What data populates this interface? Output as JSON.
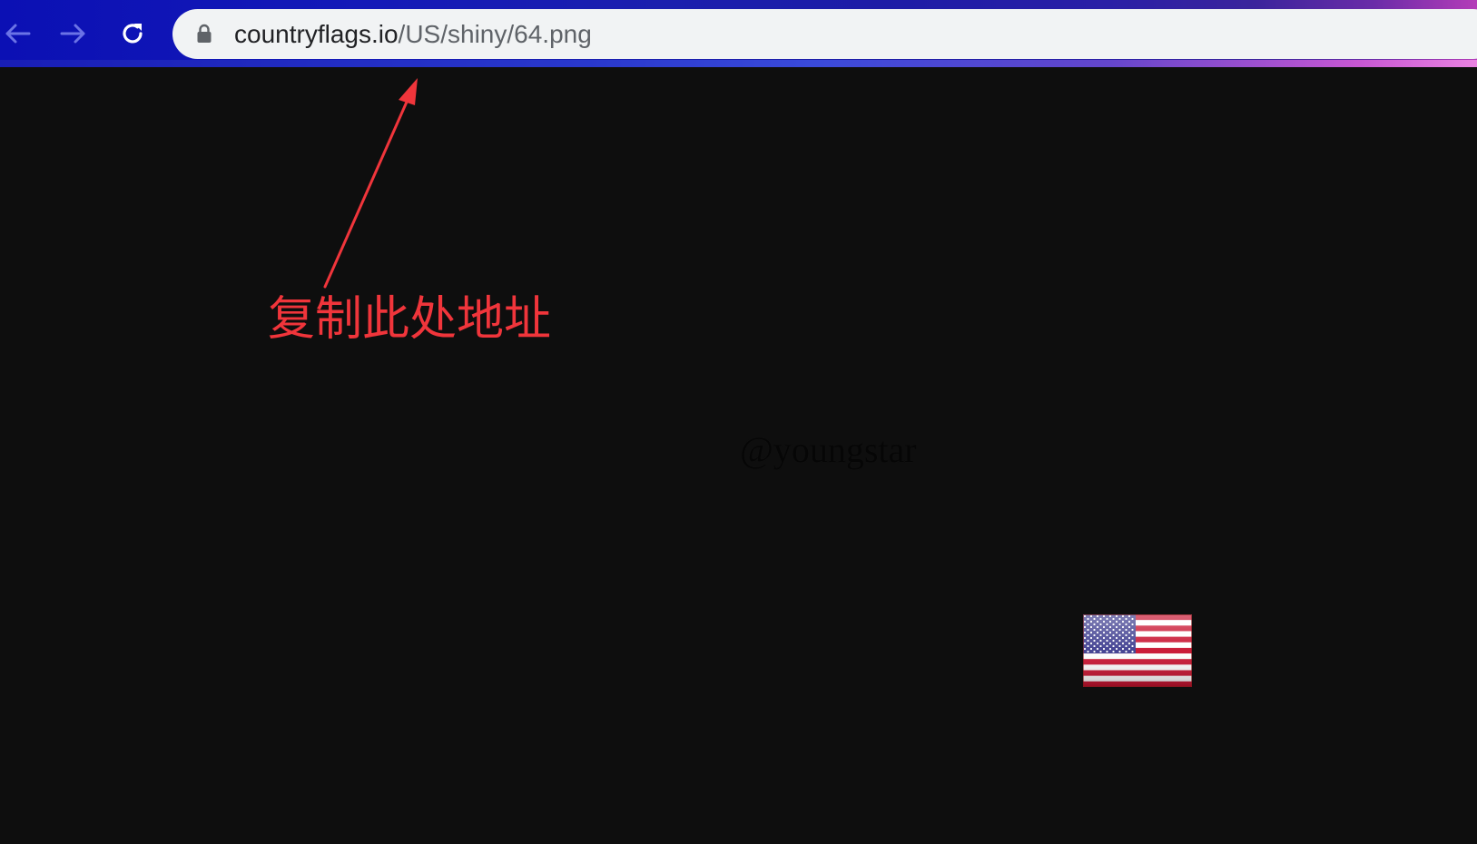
{
  "browser": {
    "url": {
      "host": "countryflags.io",
      "path": "/US/shiny/64.png"
    },
    "icons": {
      "back": "arrow-left-icon",
      "forward": "arrow-right-icon",
      "reload": "reload-icon",
      "security": "lock-icon"
    },
    "colors": {
      "toolbar": "#141ab8",
      "omnibox": "#f1f3f4"
    }
  },
  "page": {
    "background": "#0e0e0e",
    "annotation": {
      "label": "复制此处地址",
      "color": "#f0353b"
    },
    "watermark": "@youngstar",
    "flag_icon": "us-flag-icon"
  }
}
